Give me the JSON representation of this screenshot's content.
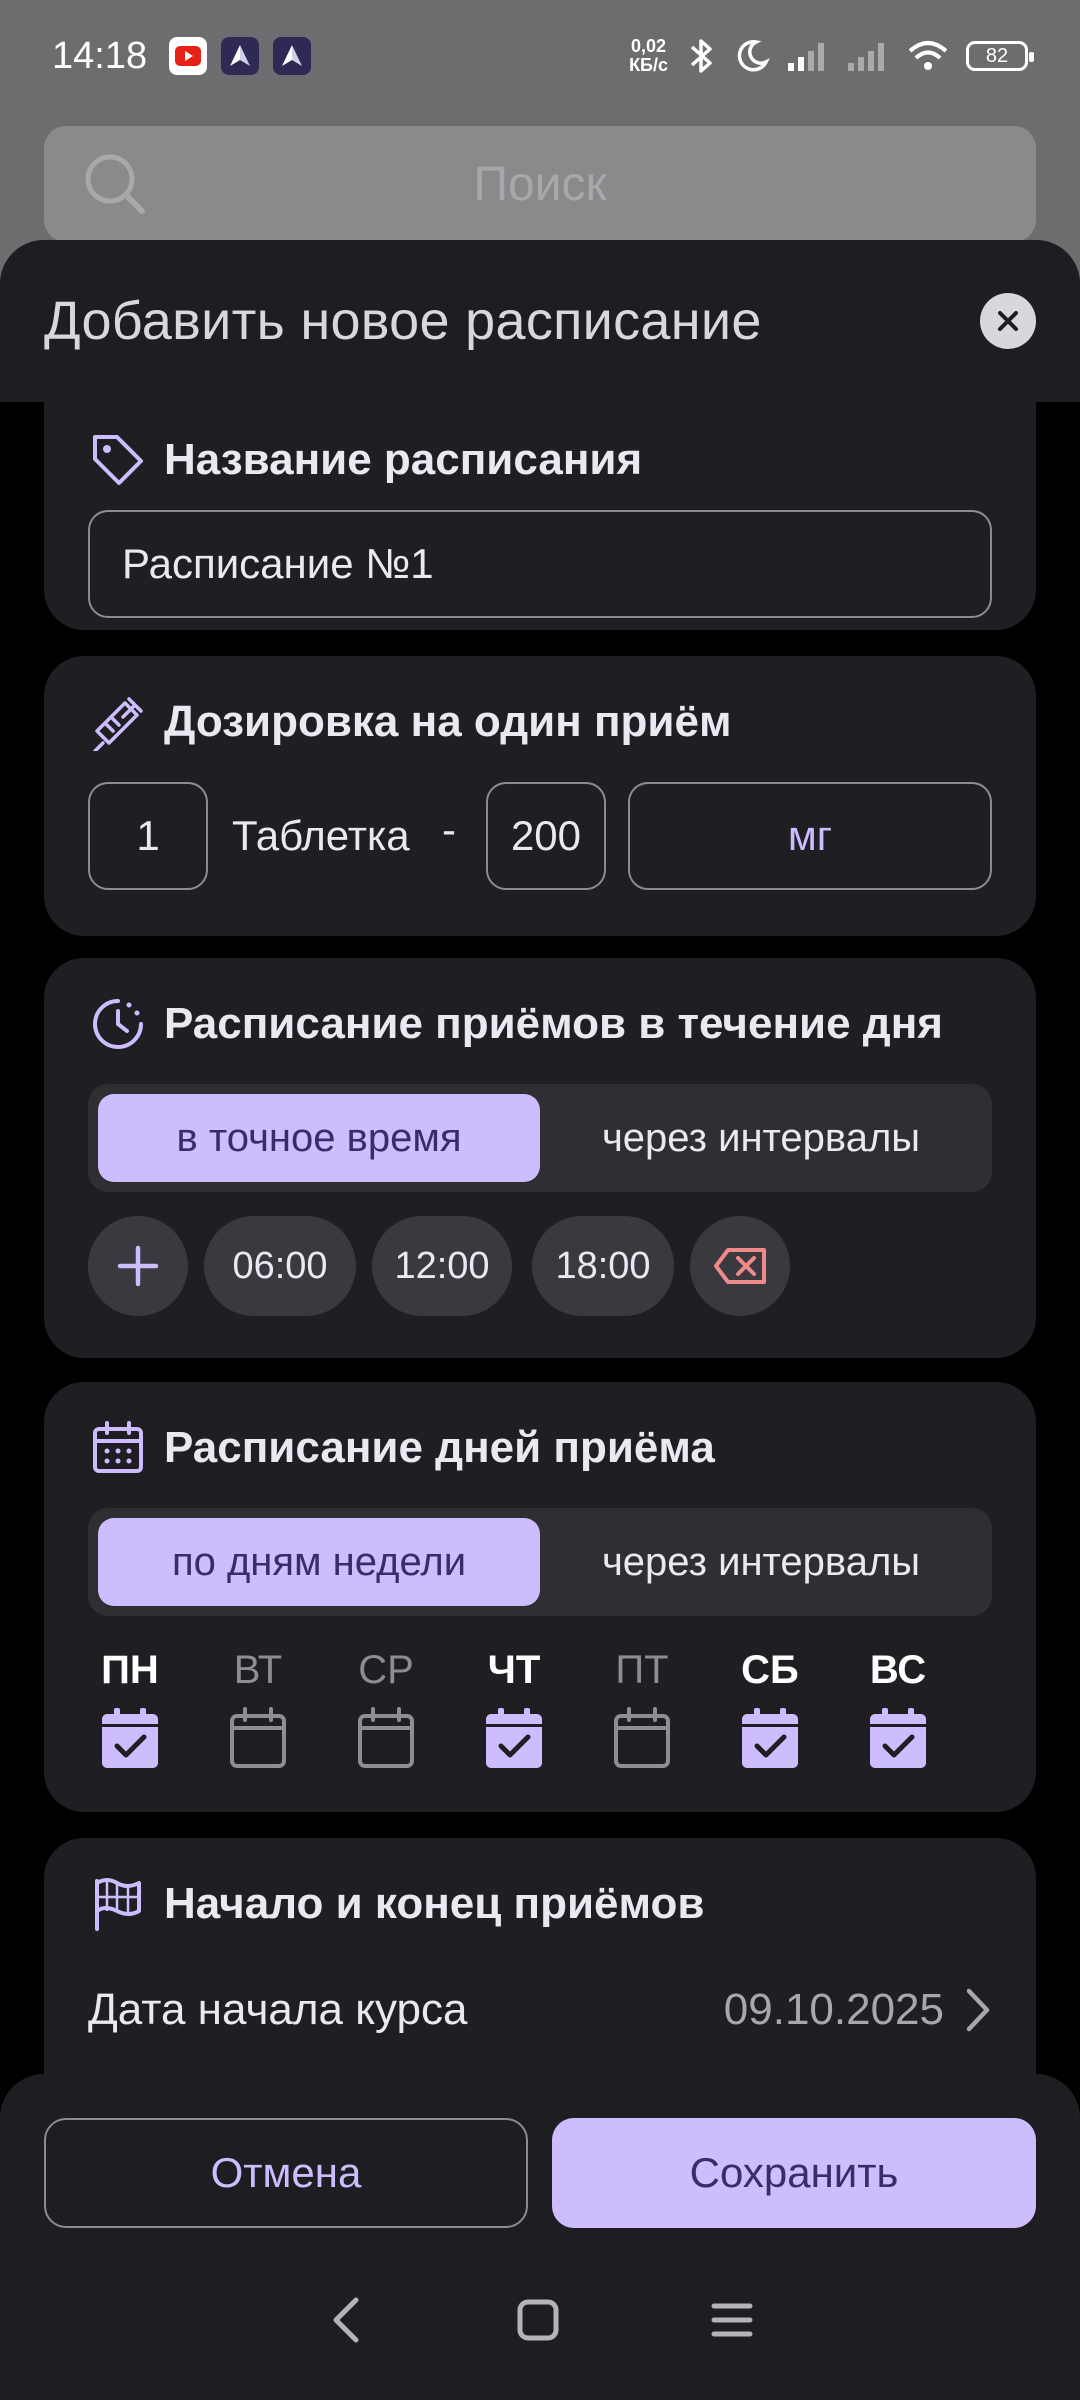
{
  "status_bar": {
    "time": "14:18",
    "net_speed_value": "0,02",
    "net_speed_unit": "КБ/с",
    "battery": "82"
  },
  "search": {
    "placeholder": "Поиск"
  },
  "sheet": {
    "title": "Добавить новое расписание"
  },
  "name_card": {
    "title": "Название расписания",
    "value": "Расписание №1",
    "icon": "tag-icon"
  },
  "dose_card": {
    "title": "Дозировка на один приём",
    "icon": "syringe-icon",
    "quantity": "1",
    "form": "Таблетка",
    "separator": "-",
    "amount": "200",
    "unit": "мг"
  },
  "times_card": {
    "title": "Расписание приёмов в течение дня",
    "icon": "clock-icon",
    "mode_exact": "в точное время",
    "mode_interval": "через интервалы",
    "times": [
      "06:00",
      "12:00",
      "18:00"
    ]
  },
  "days_card": {
    "title": "Расписание дней приёма",
    "icon": "calendar-icon",
    "mode_week": "по дням недели",
    "mode_interval": "через интервалы",
    "days": [
      {
        "label": "ПН",
        "checked": true
      },
      {
        "label": "ВТ",
        "checked": false
      },
      {
        "label": "СР",
        "checked": false
      },
      {
        "label": "ЧТ",
        "checked": true
      },
      {
        "label": "ПТ",
        "checked": false
      },
      {
        "label": "СБ",
        "checked": true
      },
      {
        "label": "ВС",
        "checked": true
      }
    ]
  },
  "period_card": {
    "title": "Начало и конец приёмов",
    "icon": "flag-icon",
    "start_label": "Дата начала курса",
    "start_value": "09.10.2025"
  },
  "actions": {
    "cancel": "Отмена",
    "save": "Сохранить"
  },
  "colors": {
    "accent": "#CDBDFF",
    "card": "#1f1e23",
    "danger": "#F08A8A"
  }
}
